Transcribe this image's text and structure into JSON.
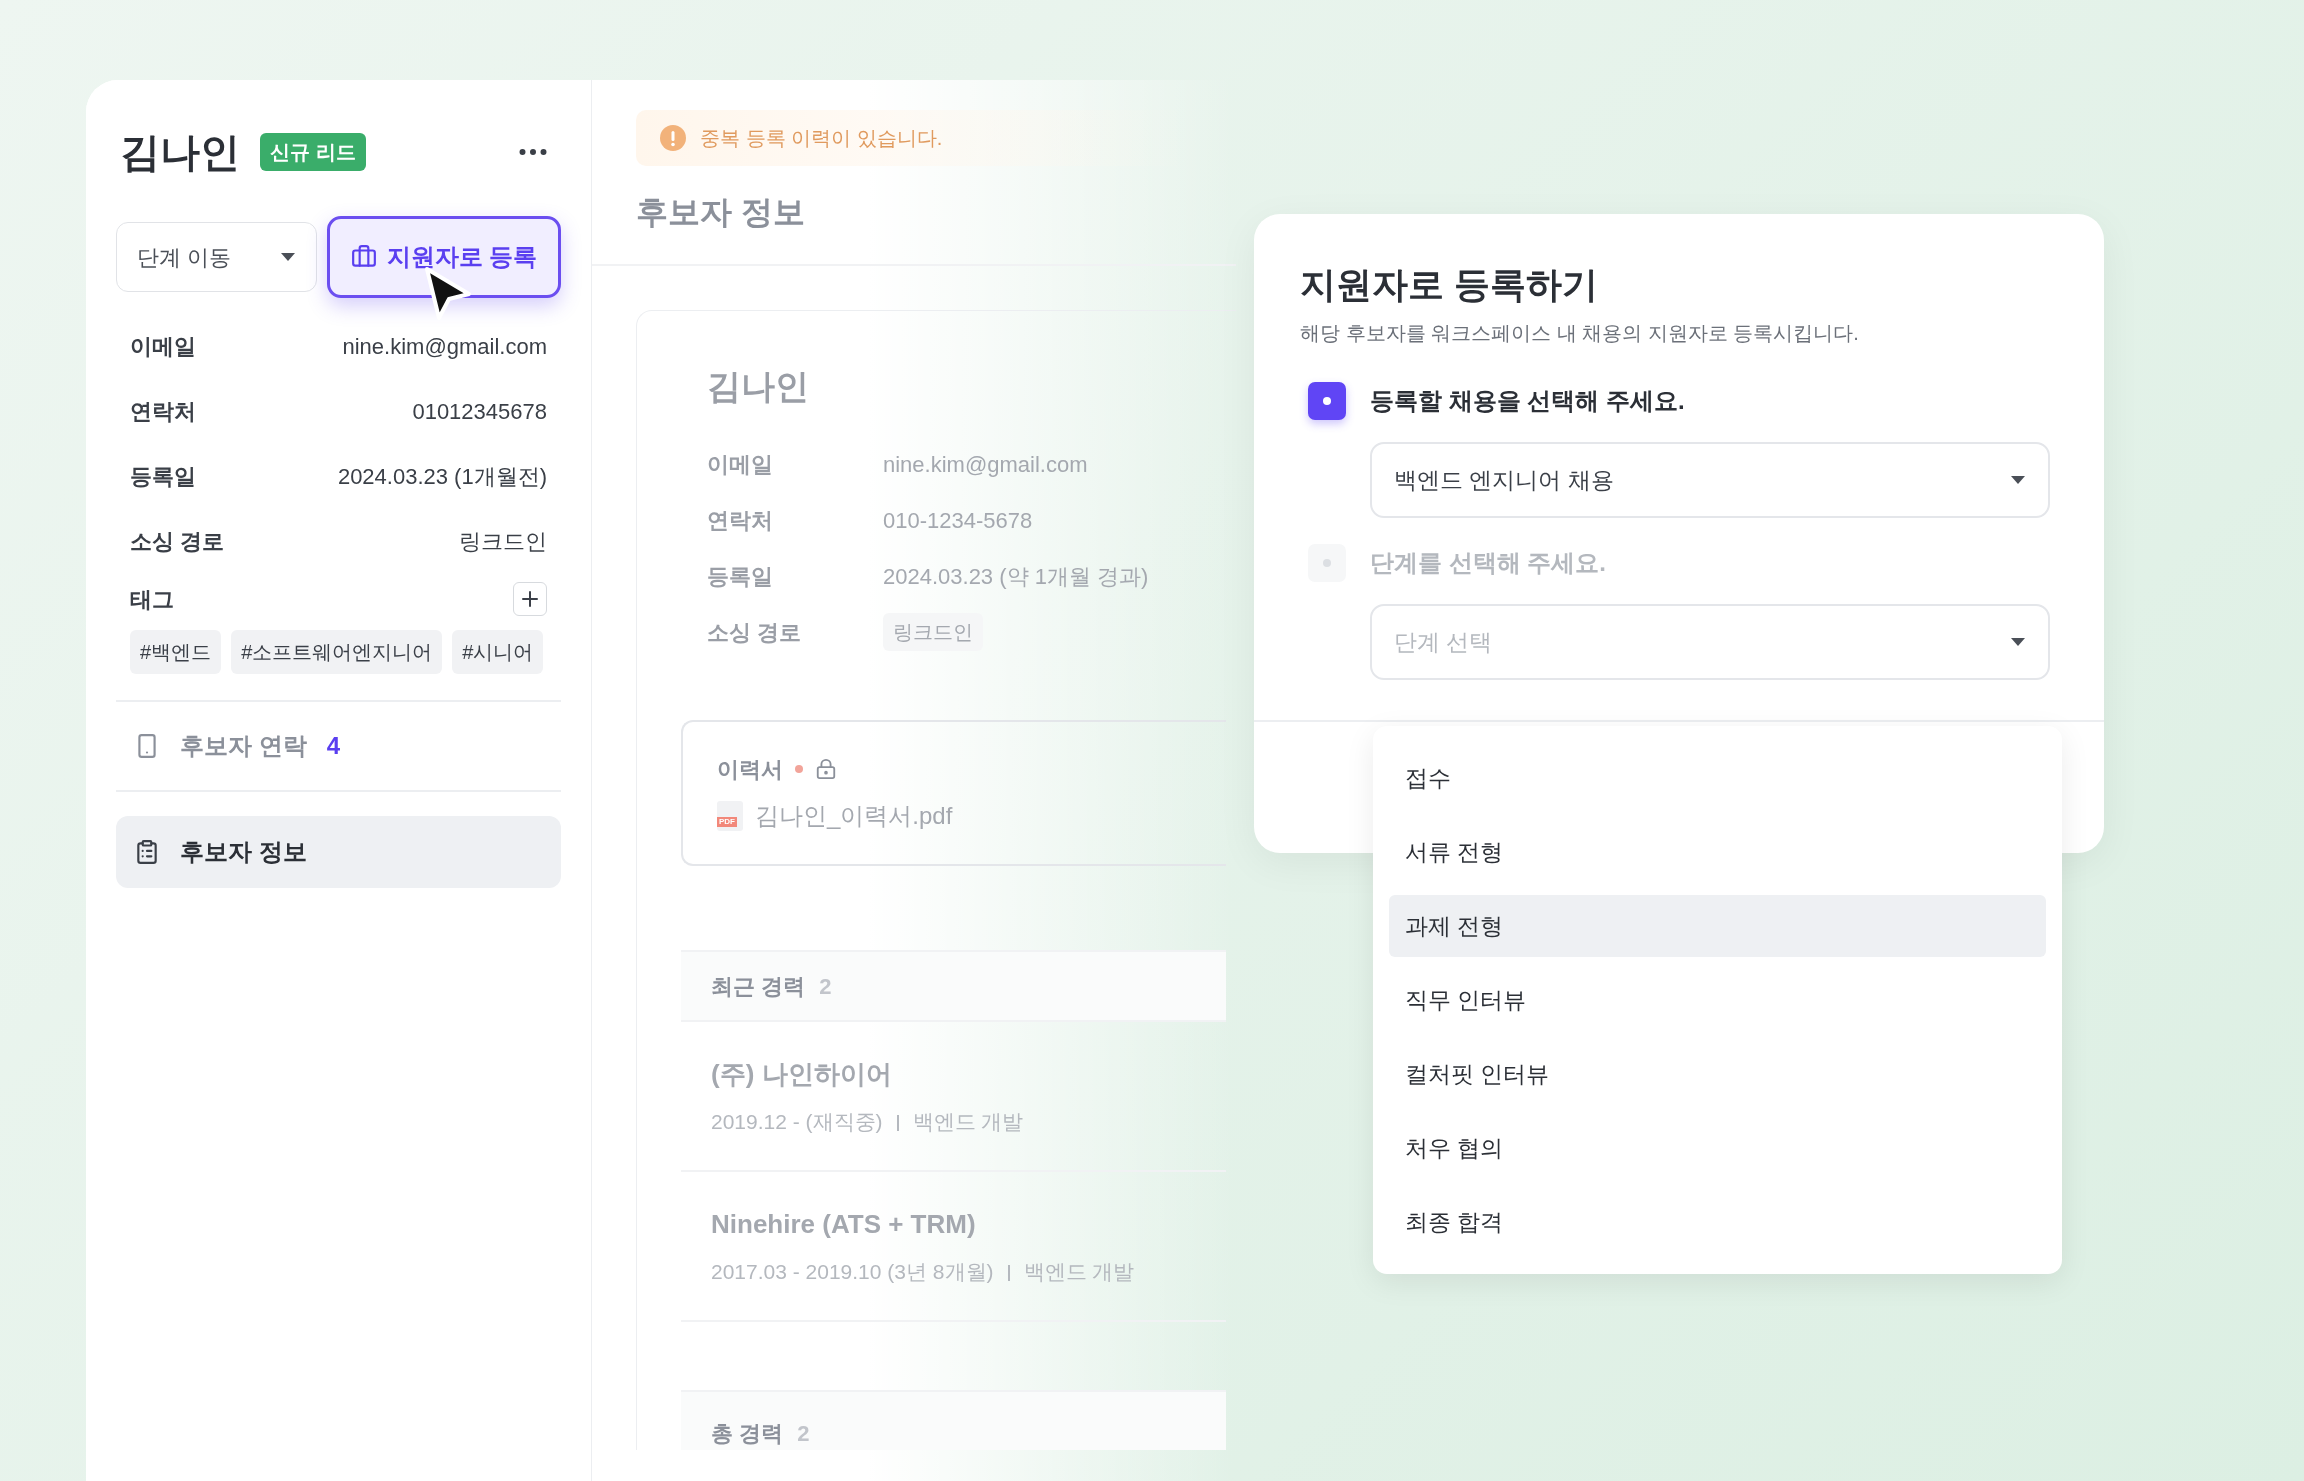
{
  "candidate": {
    "name": "김나인",
    "badge": "신규 리드",
    "fields": [
      {
        "label": "이메일",
        "value": "nine.kim@gmail.com"
      },
      {
        "label": "연락처",
        "value": "01012345678"
      },
      {
        "label": "등록일",
        "value": "2024.03.23 (1개월전)"
      },
      {
        "label": "소싱 경로",
        "value": "링크드인"
      }
    ],
    "tags_label": "태그",
    "tags": [
      "#백엔드",
      "#소프트웨어엔지니어",
      "#시니어"
    ]
  },
  "stage_move": {
    "label": "단계 이동"
  },
  "register_button": {
    "label": "지원자로 등록"
  },
  "nav": [
    {
      "kind": "phone",
      "label": "후보자 연락",
      "count": "4",
      "selected": false
    },
    {
      "kind": "clipboard",
      "label": "후보자 정보",
      "selected": true
    }
  ],
  "alert": "중복 등록 이력이 있습니다.",
  "section_title": "후보자 정보",
  "profile": {
    "name": "김나인",
    "fields": [
      {
        "kind": "text",
        "label": "이메일",
        "value": "nine.kim@gmail.com"
      },
      {
        "kind": "text",
        "label": "연락처",
        "value": "010-1234-5678"
      },
      {
        "kind": "text",
        "label": "등록일",
        "value": "2024.03.23 (약 1개월 경과)"
      },
      {
        "kind": "chip",
        "label": "소싱 경로",
        "value": "링크드인"
      }
    ]
  },
  "resume": {
    "label": "이력서",
    "file_badge": "PDF",
    "file": "김나인_이력서.pdf"
  },
  "recent_career": {
    "title": "최근 경력",
    "count": "2",
    "items": [
      {
        "company": "(주) 나인하이어",
        "period": "2019.12 - (재직중)",
        "role": "백엔드 개발"
      },
      {
        "company": "Ninehire (ATS + TRM)",
        "period": "2017.03 - 2019.10 (3년 8개월)",
        "role": "백엔드 개발"
      }
    ]
  },
  "total_career": {
    "title": "총 경력",
    "count": "2"
  },
  "dialog": {
    "title": "지원자로 등록하기",
    "description": "해당 후보자를 워크스페이스 내 채용의 지원자로 등록시킵니다.",
    "steps": [
      {
        "label": "등록할 채용을 선택해 주세요.",
        "active": true,
        "value": "백엔드 엔지니어 채용"
      },
      {
        "label": "단계를 선택해 주세요.",
        "active": false,
        "placeholder": "단계 선택"
      }
    ],
    "options": [
      {
        "label": "접수",
        "selected": false
      },
      {
        "label": "서류 전형",
        "selected": false
      },
      {
        "label": "과제 전형",
        "selected": true
      },
      {
        "label": "직무 인터뷰",
        "selected": false
      },
      {
        "label": "컬처핏 인터뷰",
        "selected": false
      },
      {
        "label": "처우 협의",
        "selected": false
      },
      {
        "label": "최종 합격",
        "selected": false
      }
    ]
  }
}
